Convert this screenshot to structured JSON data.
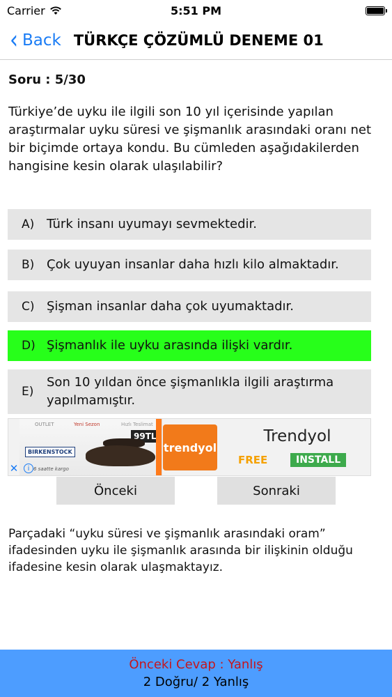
{
  "status_bar": {
    "carrier": "Carrier",
    "time": "5:51 PM"
  },
  "nav": {
    "back_label": "Back",
    "title": "TÜRKÇE ÇÖZÜMLÜ DENEME 01"
  },
  "question": {
    "number_label": "Soru : 5/30",
    "text": "Türkiye’de uyku ile ilgili son 10 yıl içerisinde yapılan araştırmalar uyku süresi ve şişmanlık arasındaki oranı net bir biçimde ortaya kondu.  Bu cümleden aşağıdakilerden hangisine kesin olarak ulaşılabilir?"
  },
  "options": [
    {
      "letter": "A)",
      "text": "Türk insanı uyumayı sevmektedir.",
      "correct": false
    },
    {
      "letter": "B)",
      "text": "Çok uyuyan insanlar daha hızlı kilo almaktadır.",
      "correct": false
    },
    {
      "letter": "C)",
      "text": "Şişman insanlar daha çok uyumaktadır.",
      "correct": false
    },
    {
      "letter": "D)",
      "text": "Şişmanlık ile uyku arasında ilişki vardır.",
      "correct": true
    },
    {
      "letter": "E)",
      "text": "Son 10 yıldan önce şişmanlıkla ilgili araştırma yapılmamıştır.",
      "correct": false
    }
  ],
  "ad": {
    "outlet": "OUTLET",
    "sezon": "Yeni Sezon",
    "teslim": "Hızlı Teslimat",
    "price": "99TL",
    "brand": "BIRKENSTOCK",
    "kargo": "6 saatte kargo",
    "logo_text": "trendyol",
    "name": "Trendyol",
    "free": "FREE",
    "install": "INSTALL"
  },
  "buttons": {
    "prev": "Önceki",
    "next": "Sonraki"
  },
  "explanation": "Parçadaki “uyku süresi ve şişmanlık arasındaki oram” ifadesinden uyku ile şişmanlık arasında bir ilişkinin olduğu ifadesine kesin olarak ulaşmaktayız.",
  "footer": {
    "previous_answer": "Önceki Cevap : Yanlış",
    "score": "2 Doğru/ 2 Yanlış"
  },
  "colors": {
    "accent": "#1a7cf5",
    "correct_option": "#27ff1a",
    "option_bg": "#e5e5e5",
    "footer_bg": "#4d9dff",
    "footer_wrong": "#c4161c"
  }
}
